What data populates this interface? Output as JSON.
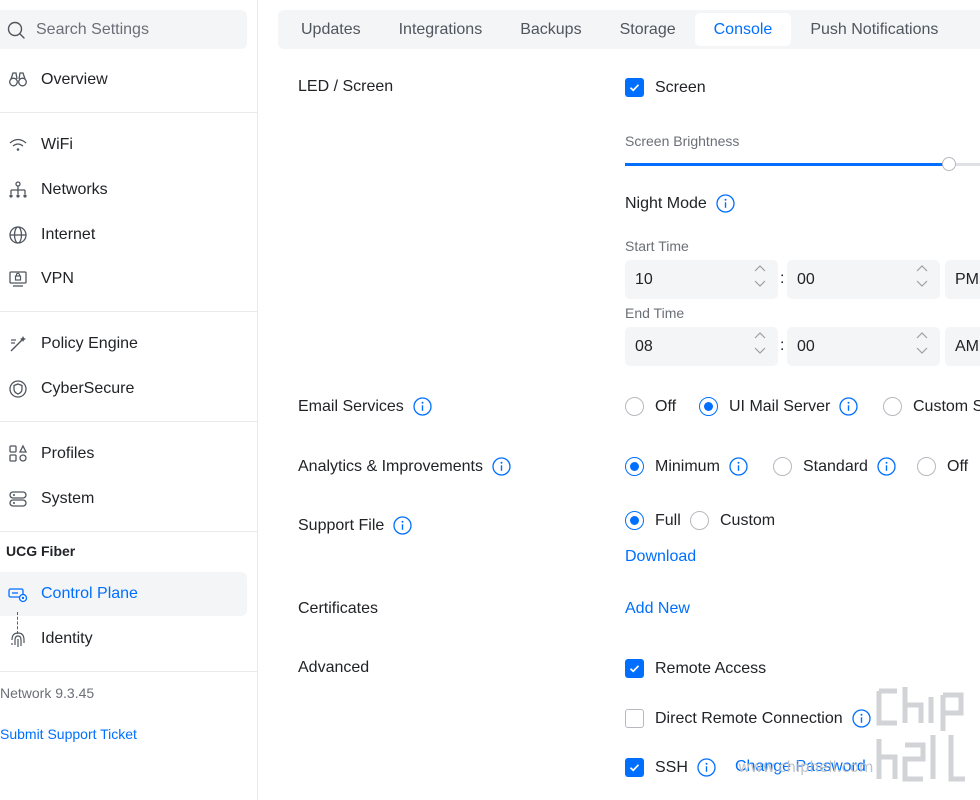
{
  "sidebar": {
    "search_placeholder": "Search Settings",
    "items": [
      {
        "label": "Overview",
        "icon": "binoculars-icon"
      },
      {
        "label": "WiFi",
        "icon": "wifi-icon"
      },
      {
        "label": "Networks",
        "icon": "network-tree-icon"
      },
      {
        "label": "Internet",
        "icon": "globe-icon"
      },
      {
        "label": "VPN",
        "icon": "vpn-icon"
      },
      {
        "label": "Policy Engine",
        "icon": "wand-icon"
      },
      {
        "label": "CyberSecure",
        "icon": "shield-icon"
      },
      {
        "label": "Profiles",
        "icon": "profiles-icon"
      },
      {
        "label": "System",
        "icon": "system-icon"
      }
    ],
    "section_title": "UCG Fiber",
    "device_items": [
      {
        "label": "Control Plane",
        "icon": "control-plane-icon",
        "active": true
      },
      {
        "label": "Identity",
        "icon": "fingerprint-icon"
      }
    ],
    "version": "Network 9.3.45",
    "support_link": "Submit Support Ticket"
  },
  "tabs": [
    {
      "label": "Updates"
    },
    {
      "label": "Integrations"
    },
    {
      "label": "Backups"
    },
    {
      "label": "Storage"
    },
    {
      "label": "Console",
      "active": true
    },
    {
      "label": "Push Notifications"
    }
  ],
  "led": {
    "label": "LED / Screen",
    "screen_checkbox_label": "Screen",
    "screen_checked": true,
    "brightness_label": "Screen Brightness",
    "brightness_value": 0.9,
    "night_mode_label": "Night Mode",
    "start_time_label": "Start Time",
    "start_hour": "10",
    "start_minute": "00",
    "start_period": "PM",
    "end_time_label": "End Time",
    "end_hour": "08",
    "end_minute": "00",
    "end_period": "AM",
    "separator": ":"
  },
  "email": {
    "label": "Email Services",
    "options": [
      "Off",
      "UI Mail Server",
      "Custom S"
    ],
    "selected": "UI Mail Server"
  },
  "analytics": {
    "label": "Analytics & Improvements",
    "options": [
      "Minimum",
      "Standard",
      "Off"
    ],
    "selected": "Minimum"
  },
  "support_file": {
    "label": "Support File",
    "options": [
      "Full",
      "Custom"
    ],
    "selected": "Full",
    "download_label": "Download"
  },
  "certificates": {
    "label": "Certificates",
    "add_new_label": "Add New"
  },
  "advanced": {
    "label": "Advanced",
    "remote_access_label": "Remote Access",
    "remote_access_checked": true,
    "direct_remote_label": "Direct Remote Connection",
    "direct_remote_checked": false,
    "ssh_label": "SSH",
    "ssh_checked": true,
    "change_password_label": "Change Password"
  },
  "watermark": {
    "text": "www.chiphell.com"
  },
  "colors": {
    "accent": "#006fff",
    "text": "#212327",
    "muted": "#6b6f77",
    "panel": "#f4f5f6"
  }
}
